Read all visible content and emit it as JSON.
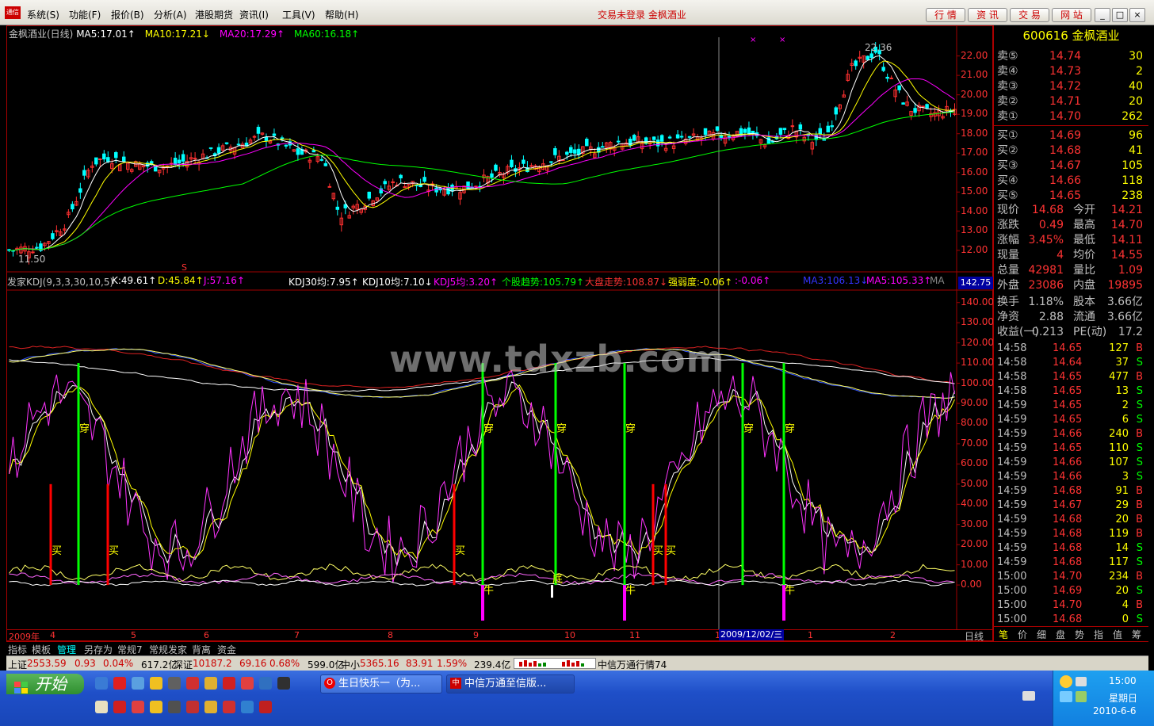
{
  "menubar": {
    "logo": "通信",
    "items": [
      "系统(S)",
      "功能(F)",
      "报价(B)",
      "分析(A)",
      "港股期货",
      "资讯(I)",
      "工具(V)",
      "帮助(H)"
    ],
    "status": "交易未登录 金枫酒业",
    "buttons": [
      "行 情",
      "资 讯",
      "交 易",
      "网 站"
    ],
    "win_min": "_",
    "win_max": "□",
    "win_close": "×"
  },
  "kline_header": {
    "title": "金枫酒业(日线)",
    "ma5": "MA5:17.01↑",
    "ma10": "MA10:17.21↓",
    "ma20": "MA20:17.29↑",
    "ma60": "MA60:16.18↑",
    "high_label": "22.36",
    "low_label": "11.50",
    "s_marker": "S",
    "x_markers": [
      "×",
      "×"
    ]
  },
  "kdj_header": {
    "name": "发家KDJ(9,3,3,30,10,5)",
    "k": "K:49.61↑",
    "d": "D:45.84↑",
    "j": "J:57.16↑",
    "kdj30": "KDJ30均:7.95↑",
    "kdj10": "KDJ10均:7.10↓",
    "kdj5": "KDJ5均:3.20↑",
    "trend": "个股趋势:105.79↑",
    "market": "大盘走势:108.87↓",
    "strength": "强弱度:-0.06↑",
    "x": ":-0.06↑",
    "ma3": "MA3:106.13↓",
    "ma5": "MA5:105.33↑",
    "ma": "MA",
    "corner_value": "142.75"
  },
  "price_axis": [
    "22.00",
    "21.00",
    "20.00",
    "19.00",
    "18.00",
    "17.00",
    "16.00",
    "15.00",
    "14.00",
    "13.00",
    "12.00"
  ],
  "ind_axis": [
    "140.00",
    "130.00",
    "120.00",
    "110.00",
    "100.00",
    "90.00",
    "80.00",
    "70.00",
    "60.00",
    "50.00",
    "40.00",
    "30.00",
    "20.00",
    "10.00",
    "0.00"
  ],
  "signals": {
    "buy": "买",
    "cross": "穿",
    "bull": "牛",
    "bottom": "底"
  },
  "time_axis": {
    "labels": [
      "2009年",
      "4",
      "5",
      "6",
      "7",
      "8",
      "9",
      "10",
      "11",
      "1",
      "1",
      "2"
    ],
    "cursor_date": "2009/12/02/三",
    "period": "日线"
  },
  "watermark": "www.tdxzb.com",
  "quote": {
    "code_name": "600616 金枫酒业",
    "sell": [
      {
        "label": "卖⑤",
        "price": "14.74",
        "vol": "30"
      },
      {
        "label": "卖④",
        "price": "14.73",
        "vol": "2"
      },
      {
        "label": "卖③",
        "price": "14.72",
        "vol": "40"
      },
      {
        "label": "卖②",
        "price": "14.71",
        "vol": "20"
      },
      {
        "label": "卖①",
        "price": "14.70",
        "vol": "262"
      }
    ],
    "buy": [
      {
        "label": "买①",
        "price": "14.69",
        "vol": "96"
      },
      {
        "label": "买②",
        "price": "14.68",
        "vol": "41"
      },
      {
        "label": "买③",
        "price": "14.67",
        "vol": "105"
      },
      {
        "label": "买④",
        "price": "14.66",
        "vol": "118"
      },
      {
        "label": "买⑤",
        "price": "14.65",
        "vol": "238"
      }
    ],
    "stats": [
      {
        "l1": "现价",
        "v1": "14.68",
        "l2": "今开",
        "v2": "14.21"
      },
      {
        "l1": "涨跌",
        "v1": "0.49",
        "l2": "最高",
        "v2": "14.70"
      },
      {
        "l1": "涨幅",
        "v1": "3.45%",
        "l2": "最低",
        "v2": "14.11"
      },
      {
        "l1": "现量",
        "v1": "4",
        "l2": "均价",
        "v2": "14.55"
      },
      {
        "l1": "总量",
        "v1": "42981",
        "l2": "量比",
        "v2": "1.09"
      },
      {
        "l1": "外盘",
        "v1": "23086",
        "l2": "内盘",
        "v2": "19895"
      }
    ],
    "stats2": [
      {
        "l1": "换手",
        "v1": "1.18%",
        "l2": "股本",
        "v2": "3.66亿"
      },
      {
        "l1": "净资",
        "v1": "2.88",
        "l2": "流通",
        "v2": "3.66亿"
      },
      {
        "l1": "收益(一)",
        "v1": "0.213",
        "l2": "PE(动)",
        "v2": "17.2"
      }
    ],
    "ticks": [
      {
        "t": "14:58",
        "p": "14.65",
        "v": "127",
        "d": "B"
      },
      {
        "t": "14:58",
        "p": "14.64",
        "v": "37",
        "d": "S"
      },
      {
        "t": "14:58",
        "p": "14.65",
        "v": "477",
        "d": "B"
      },
      {
        "t": "14:58",
        "p": "14.65",
        "v": "13",
        "d": "S"
      },
      {
        "t": "14:59",
        "p": "14.65",
        "v": "2",
        "d": "S"
      },
      {
        "t": "14:59",
        "p": "14.65",
        "v": "6",
        "d": "S"
      },
      {
        "t": "14:59",
        "p": "14.66",
        "v": "240",
        "d": "B"
      },
      {
        "t": "14:59",
        "p": "14.65",
        "v": "110",
        "d": "S"
      },
      {
        "t": "14:59",
        "p": "14.66",
        "v": "107",
        "d": "S"
      },
      {
        "t": "14:59",
        "p": "14.66",
        "v": "3",
        "d": "S"
      },
      {
        "t": "14:59",
        "p": "14.68",
        "v": "91",
        "d": "B"
      },
      {
        "t": "14:59",
        "p": "14.67",
        "v": "29",
        "d": "B"
      },
      {
        "t": "14:59",
        "p": "14.68",
        "v": "20",
        "d": "B"
      },
      {
        "t": "14:59",
        "p": "14.68",
        "v": "119",
        "d": "B"
      },
      {
        "t": "14:59",
        "p": "14.68",
        "v": "14",
        "d": "S"
      },
      {
        "t": "14:59",
        "p": "14.68",
        "v": "117",
        "d": "S"
      },
      {
        "t": "15:00",
        "p": "14.70",
        "v": "234",
        "d": "B"
      },
      {
        "t": "15:00",
        "p": "14.69",
        "v": "20",
        "d": "S"
      },
      {
        "t": "15:00",
        "p": "14.70",
        "v": "4",
        "d": "B"
      },
      {
        "t": "15:00",
        "p": "14.68",
        "v": "0",
        "d": "S"
      }
    ],
    "bottom_tabs": [
      "笔",
      "价",
      "细",
      "盘",
      "势",
      "指",
      "值",
      "筹"
    ]
  },
  "tabs": [
    "指标",
    "模板",
    "管理",
    "另存为",
    "常规7",
    "常规发家",
    "背离",
    "资金"
  ],
  "indexbar": {
    "sh_name": "上证",
    "sh_val": "2553.59",
    "sh_chg": "0.93",
    "sh_pct": "0.04%",
    "sh_amt": "617.2亿",
    "sz_name": "深证",
    "sz_val": "10187.2",
    "sz_chg": "69.16",
    "sz_pct": "0.68%",
    "sz_amt": "599.0亿",
    "zx_name": "中小",
    "zx_val": "5365.16",
    "zx_chg": "83.91",
    "zx_pct": "1.59%",
    "zx_amt": "239.4亿",
    "app_name": "中信万通行情74"
  },
  "taskbar": {
    "start": "开始",
    "tasks": [
      "生日快乐一（为...",
      "中信万通至信版..."
    ],
    "clock": "15:00",
    "weekday": "星期日",
    "date": "2010-6-6"
  },
  "colors": {
    "up": "#ff3030",
    "down": "#00ffff",
    "ma5": "#ffffff",
    "ma10": "#ffff00",
    "ma20": "#ff00ff",
    "ma60": "#00ff00",
    "frame": "#a00000",
    "label_yellow": "#ffff00",
    "buy_signal": "#ff0000",
    "cross_signal": "#00ff00",
    "bull_signal": "#ff00ff"
  }
}
